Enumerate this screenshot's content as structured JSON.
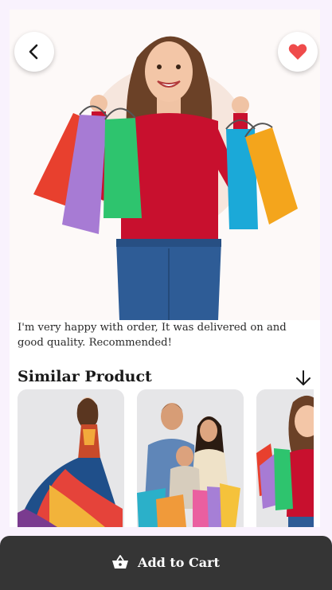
{
  "product": {
    "review_text": "I'm very happy with order, It was delivered on and good quality. Recommended!"
  },
  "similar": {
    "title": "Similar Product",
    "items": [
      {
        "name": "gown-thumb"
      },
      {
        "name": "family-shopping-thumb"
      },
      {
        "name": "woman-shopping-thumb"
      }
    ]
  },
  "actions": {
    "add_to_cart_label": "Add to Cart"
  },
  "icons": {
    "back": "chevron-left-icon",
    "favorite": "heart-icon",
    "scroll": "arrow-down-icon",
    "cart": "basket-icon"
  },
  "colors": {
    "accent_heart": "#ef4b4b",
    "cart_bar": "#353535",
    "page_bg": "#f9f2fd"
  }
}
